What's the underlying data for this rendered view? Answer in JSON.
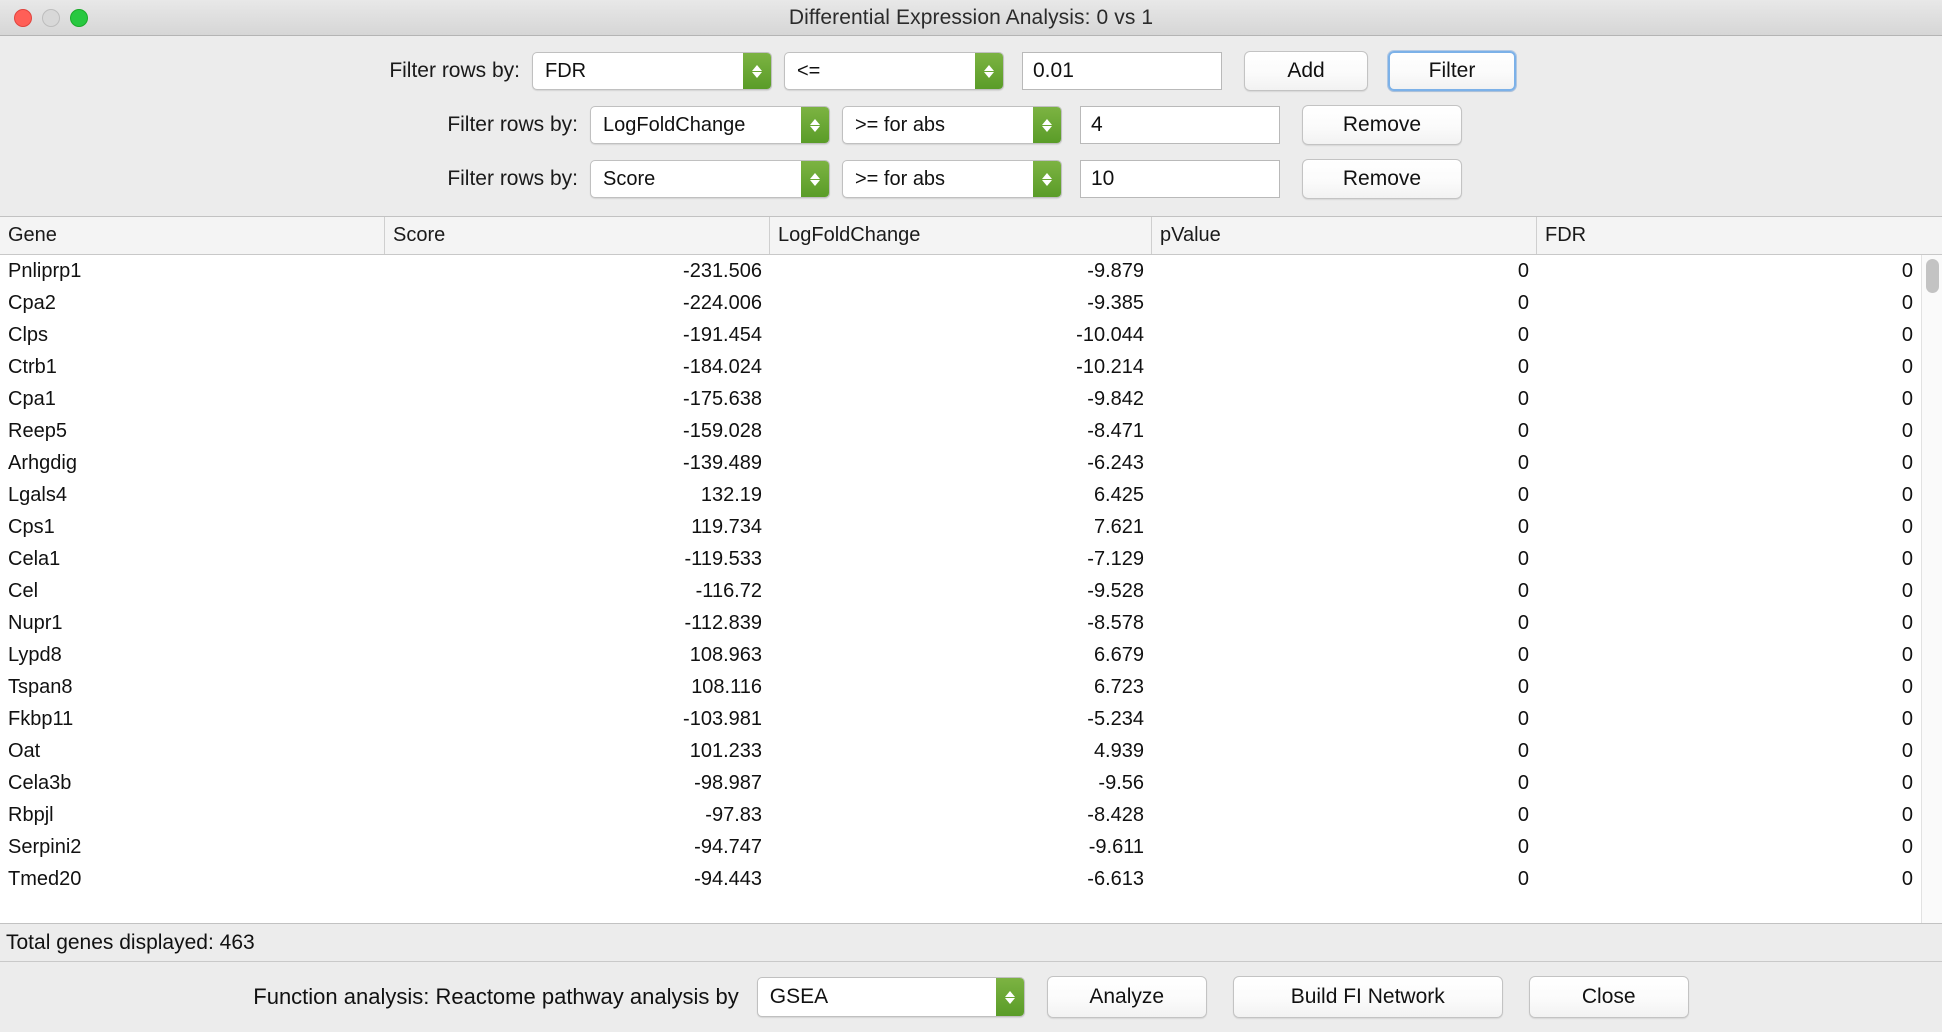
{
  "window": {
    "title": "Differential Expression Analysis: 0 vs 1",
    "traffic_lights": {
      "close": "close",
      "minimize": "minimize",
      "zoom": "zoom"
    }
  },
  "filters": {
    "label": "Filter rows by:",
    "rows": [
      {
        "label": "Filter rows by:",
        "attribute": "FDR",
        "operator": "<=",
        "value": "0.01",
        "primary_action": "Add",
        "secondary_action": "Filter"
      },
      {
        "label": "Filter rows by:",
        "attribute": "LogFoldChange",
        "operator": ">= for abs",
        "value": "4",
        "primary_action": "Remove"
      },
      {
        "label": "Filter rows by:",
        "attribute": "Score",
        "operator": ">= for abs",
        "value": "10",
        "primary_action": "Remove"
      }
    ]
  },
  "table": {
    "columns": [
      "Gene",
      "Score",
      "LogFoldChange",
      "pValue",
      "FDR"
    ],
    "rows": [
      [
        "Pnliprp1",
        "-231.506",
        "-9.879",
        "0",
        "0"
      ],
      [
        "Cpa2",
        "-224.006",
        "-9.385",
        "0",
        "0"
      ],
      [
        "Clps",
        "-191.454",
        "-10.044",
        "0",
        "0"
      ],
      [
        "Ctrb1",
        "-184.024",
        "-10.214",
        "0",
        "0"
      ],
      [
        "Cpa1",
        "-175.638",
        "-9.842",
        "0",
        "0"
      ],
      [
        "Reep5",
        "-159.028",
        "-8.471",
        "0",
        "0"
      ],
      [
        "Arhgdig",
        "-139.489",
        "-6.243",
        "0",
        "0"
      ],
      [
        "Lgals4",
        "132.19",
        "6.425",
        "0",
        "0"
      ],
      [
        "Cps1",
        "119.734",
        "7.621",
        "0",
        "0"
      ],
      [
        "Cela1",
        "-119.533",
        "-7.129",
        "0",
        "0"
      ],
      [
        "Cel",
        "-116.72",
        "-9.528",
        "0",
        "0"
      ],
      [
        "Nupr1",
        "-112.839",
        "-8.578",
        "0",
        "0"
      ],
      [
        "Lypd8",
        "108.963",
        "6.679",
        "0",
        "0"
      ],
      [
        "Tspan8",
        "108.116",
        "6.723",
        "0",
        "0"
      ],
      [
        "Fkbp11",
        "-103.981",
        "-5.234",
        "0",
        "0"
      ],
      [
        "Oat",
        "101.233",
        "4.939",
        "0",
        "0"
      ],
      [
        "Cela3b",
        "-98.987",
        "-9.56",
        "0",
        "0"
      ],
      [
        "Rbpjl",
        "-97.83",
        "-8.428",
        "0",
        "0"
      ],
      [
        "Serpini2",
        "-94.747",
        "-9.611",
        "0",
        "0"
      ],
      [
        "Tmed20",
        "-94.443",
        "-6.613",
        "0",
        "0"
      ]
    ]
  },
  "status": {
    "text": "Total genes displayed: 463"
  },
  "function_analysis": {
    "label": "Function analysis:  Reactome pathway analysis by",
    "method": "GSEA",
    "analyze_label": "Analyze",
    "build_network_label": "Build FI Network",
    "close_label": "Close"
  },
  "colors": {
    "accent_green": "#5a9c28",
    "focus_blue": "#7cb1e8",
    "close_red": "#ff5f57",
    "zoom_green": "#28c840"
  }
}
